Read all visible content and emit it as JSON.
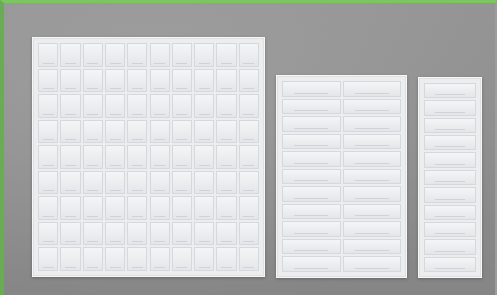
{
  "scene": {
    "description_colors": {
      "border": "#6fb35a",
      "background": "#959595",
      "tray": "#ecedef"
    }
  },
  "trays": [
    {
      "id": "large",
      "rows": 9,
      "cols": 10
    },
    {
      "id": "medium",
      "rows": 11,
      "cols": 2
    },
    {
      "id": "small",
      "rows": 11,
      "cols": 1
    }
  ]
}
